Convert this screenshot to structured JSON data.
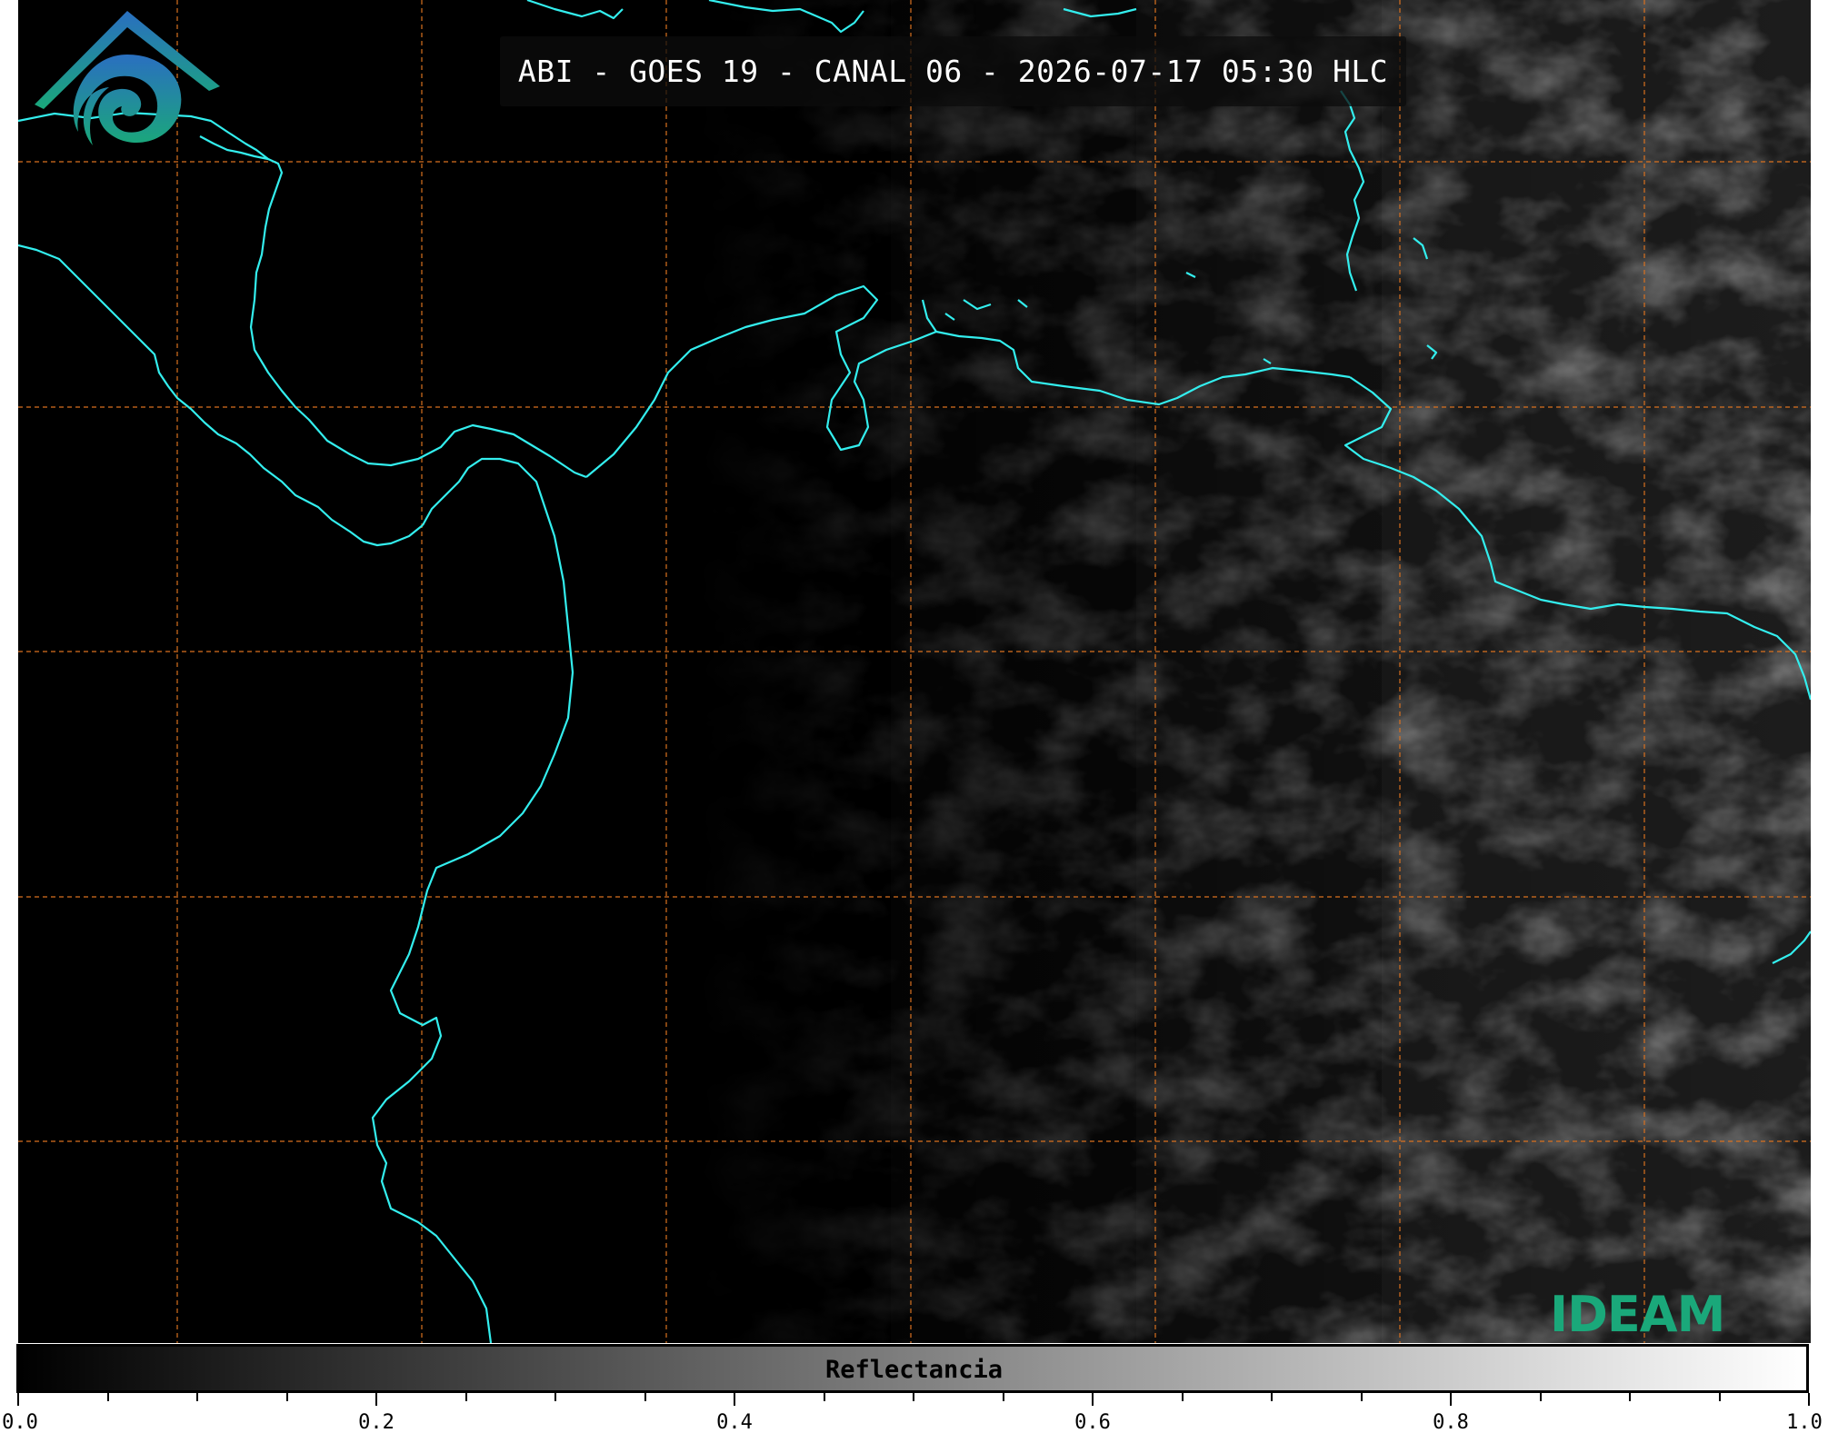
{
  "title": "ABI - GOES 19 - CANAL 06 - 2026-07-17 05:30 HLC",
  "logo_text": "IDEAM",
  "colorbar": {
    "label": "Reflectancia",
    "min": 0.0,
    "max": 1.0,
    "major_ticks": [
      "0.0",
      "0.2",
      "0.4",
      "0.6",
      "0.8",
      "1.0"
    ],
    "minor_step": 0.05,
    "gradient_from": "#000000",
    "gradient_to": "#ffffff"
  },
  "colors": {
    "coastline": "#33eeee",
    "gridlines": "#d9711f",
    "background": "#000000",
    "logo_blue": "#2a6fc0",
    "logo_green": "#1aa87a"
  }
}
